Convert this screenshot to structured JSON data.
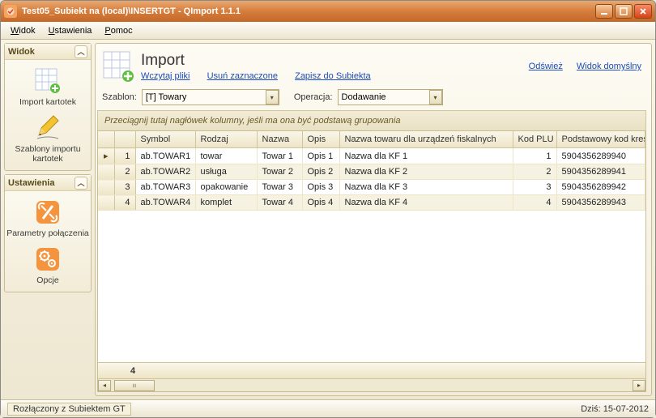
{
  "window": {
    "title": "Test05_Subiekt na (local)\\INSERTGT - QImport 1.1.1"
  },
  "menu": {
    "widok": "Widok",
    "ustawienia": "Ustawienia",
    "pomoc": "Pomoc"
  },
  "sidebar": {
    "widok": {
      "title": "Widok",
      "import_kartotek": "Import kartotek",
      "szablony": "Szablony importu kartotek"
    },
    "ustawienia": {
      "title": "Ustawienia",
      "parametry": "Parametry połączenia",
      "opcje": "Opcje"
    }
  },
  "header": {
    "title": "Import",
    "wczytaj": "Wczytaj pliki",
    "usun": "Usuń zaznaczone",
    "zapisz": "Zapisz do Subiekta",
    "odswiez": "Odśwież",
    "widok_domyslny": "Widok domyślny"
  },
  "filters": {
    "szablon_label": "Szablon:",
    "szablon_value": "[T] Towary",
    "operacja_label": "Operacja:",
    "operacja_value": "Dodawanie"
  },
  "grid": {
    "group_hint": "Przeciągnij tutaj nagłówek kolumny, jeśli ma ona być podstawą grupowania",
    "columns": [
      "Symbol",
      "Rodzaj",
      "Nazwa",
      "Opis",
      "Nazwa towaru dla urządzeń fiskalnych",
      "Kod PLU",
      "Podstawowy kod kreskowy"
    ],
    "rows": [
      {
        "n": 1,
        "symbol": "ab.TOWAR1",
        "rodzaj": "towar",
        "nazwa": "Towar 1",
        "opis": "Opis 1",
        "nazwa_fisk": "Nazwa dla KF 1",
        "kod_plu": 1,
        "kod_kreskowy": "5904356289940"
      },
      {
        "n": 2,
        "symbol": "ab.TOWAR2",
        "rodzaj": "usługa",
        "nazwa": "Towar 2",
        "opis": "Opis 2",
        "nazwa_fisk": "Nazwa dla KF 2",
        "kod_plu": 2,
        "kod_kreskowy": "5904356289941"
      },
      {
        "n": 3,
        "symbol": "ab.TOWAR3",
        "rodzaj": "opakowanie",
        "nazwa": "Towar 3",
        "opis": "Opis 3",
        "nazwa_fisk": "Nazwa dla KF 3",
        "kod_plu": 3,
        "kod_kreskowy": "5904356289942"
      },
      {
        "n": 4,
        "symbol": "ab.TOWAR4",
        "rodzaj": "komplet",
        "nazwa": "Towar 4",
        "opis": "Opis 4",
        "nazwa_fisk": "Nazwa dla KF 4",
        "kod_plu": 4,
        "kod_kreskowy": "5904356289943"
      }
    ],
    "footer_count": "4"
  },
  "status": {
    "left": "Rozłączony z Subiektem GT",
    "right_label": "Dziś:",
    "right_date": "15-07-2012"
  }
}
